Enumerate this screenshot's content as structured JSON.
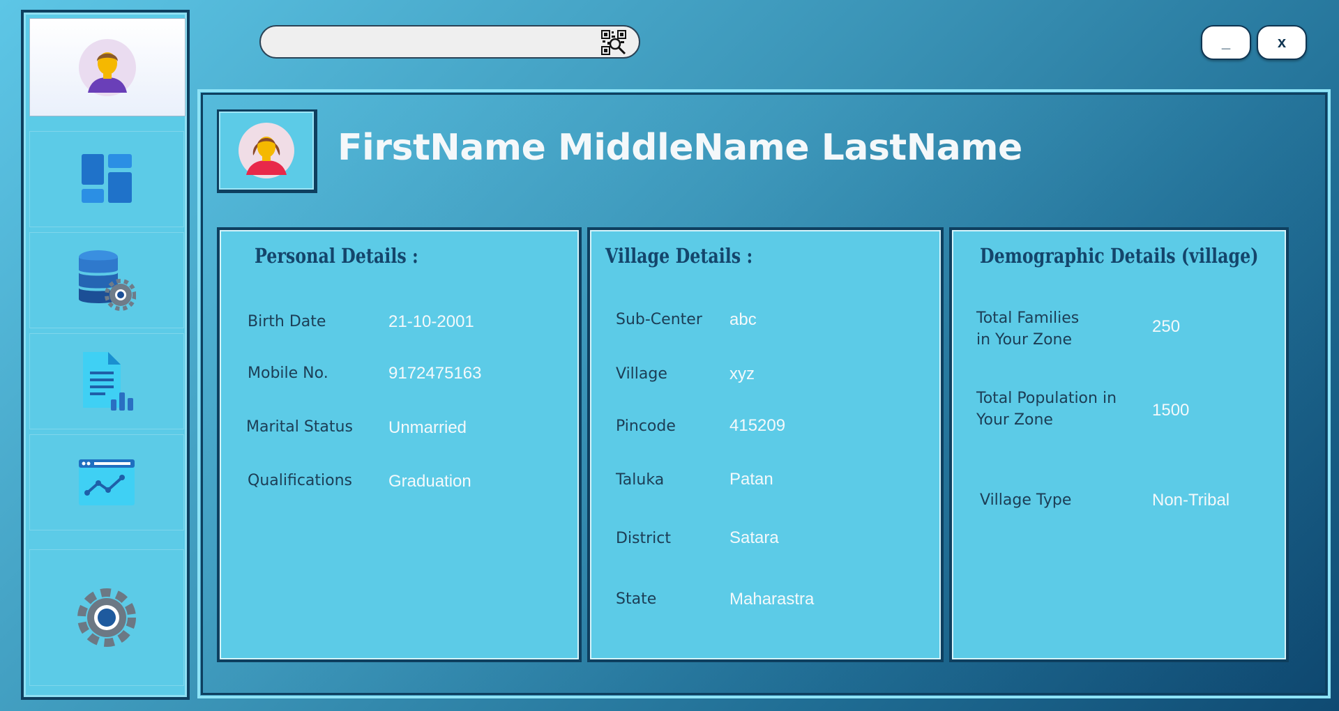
{
  "search": {
    "placeholder": "",
    "value": "",
    "scan_icon": "qr-code-search-icon"
  },
  "window_controls": {
    "minimize_label": "_",
    "close_label": "x"
  },
  "sidebar": {
    "profile_icon": "male-user-avatar-icon",
    "items": [
      {
        "name": "dashboard",
        "icon": "dashboard-layout-icon"
      },
      {
        "name": "database-settings",
        "icon": "database-gear-icon"
      },
      {
        "name": "report",
        "icon": "document-chart-icon"
      },
      {
        "name": "analytics",
        "icon": "browser-line-chart-icon"
      },
      {
        "name": "settings",
        "icon": "gear-icon"
      }
    ]
  },
  "profile": {
    "full_name": "FirstName MiddleName LastName",
    "avatar_icon": "female-user-avatar-icon"
  },
  "personal": {
    "title": "Personal Details :",
    "fields": [
      {
        "label": "Birth Date",
        "value": "21-10-2001"
      },
      {
        "label": "Mobile No.",
        "value": "9172475163"
      },
      {
        "label": "Marital Status",
        "value": "Unmarried"
      },
      {
        "label": "Qualifications",
        "value": "Graduation"
      }
    ]
  },
  "village": {
    "title": "Village Details :",
    "fields": [
      {
        "label": "Sub-Center",
        "value": "abc"
      },
      {
        "label": "Village",
        "value": "xyz"
      },
      {
        "label": "Pincode",
        "value": "415209"
      },
      {
        "label": "Taluka",
        "value": "Patan"
      },
      {
        "label": "District",
        "value": "Satara"
      },
      {
        "label": "State",
        "value": "Maharastra"
      }
    ]
  },
  "demographic": {
    "title": "Demographic Details (village)",
    "fields": [
      {
        "label_line1": "Total Families",
        "label_line2": "in Your Zone",
        "value": "250"
      },
      {
        "label_line1": "Total Population in",
        "label_line2": "Your Zone",
        "value": "1500"
      },
      {
        "label_line1": "Village Type",
        "label_line2": "",
        "value": "Non-Tribal"
      }
    ]
  },
  "colors": {
    "panel": "#5ccbe7",
    "border_dark": "#0e3f5f",
    "title_text": "#14456b",
    "value_text": "#f4f9fb"
  }
}
